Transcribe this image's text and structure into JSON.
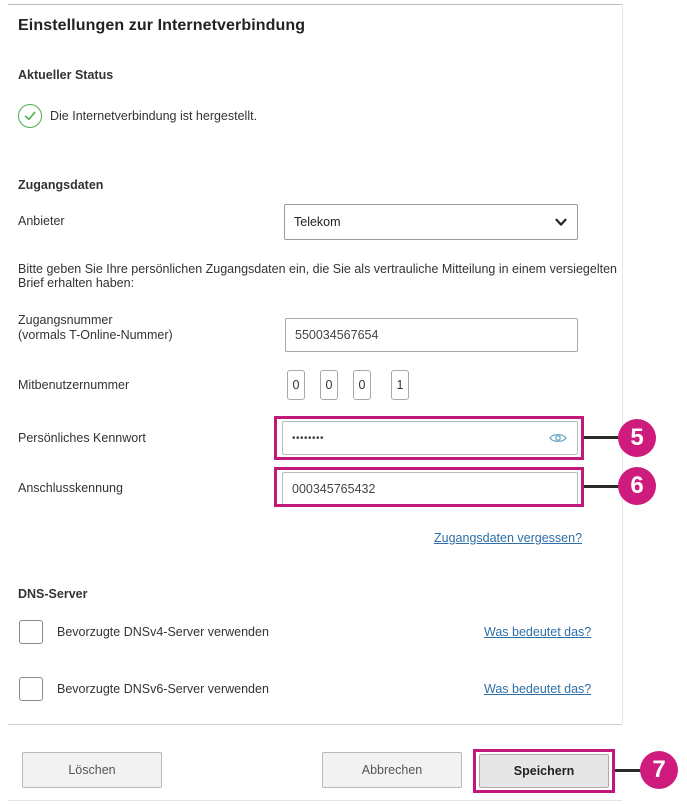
{
  "page": {
    "title": "Einstellungen zur Internetverbindung"
  },
  "status": {
    "heading": "Aktueller Status",
    "text": "Die Internetverbindung ist hergestellt."
  },
  "access": {
    "heading": "Zugangsdaten",
    "provider_label": "Anbieter",
    "provider_value": "Telekom",
    "hint": "Bitte geben Sie Ihre persönlichen Zugangsdaten ein, die Sie als vertrauliche Mitteilung in einem versiegelten Brief erhalten haben:",
    "account_label_line1": "Zugangsnummer",
    "account_label_line2": "(vormals T-Online-Nummer)",
    "account_value": "550034567654",
    "coop_label": "Mitbenutzernummer",
    "coop_digits": [
      "0",
      "0",
      "0",
      "1"
    ],
    "password_label": "Persönliches Kennwort",
    "password_value": "••••••••",
    "connection_label": "Anschlusskennung",
    "connection_value": "000345765432",
    "forgot_link": "Zugangsdaten vergessen?"
  },
  "dns": {
    "heading": "DNS-Server",
    "v4_label": "Bevorzugte DNSv4-Server verwenden",
    "v6_label": "Bevorzugte DNSv6-Server verwenden",
    "help_link": "Was bedeutet das?"
  },
  "buttons": {
    "delete": "Löschen",
    "cancel": "Abbrechen",
    "save": "Speichern"
  },
  "callouts": {
    "password": "5",
    "connection": "6",
    "save": "7",
    "color": "#d01b7e"
  }
}
